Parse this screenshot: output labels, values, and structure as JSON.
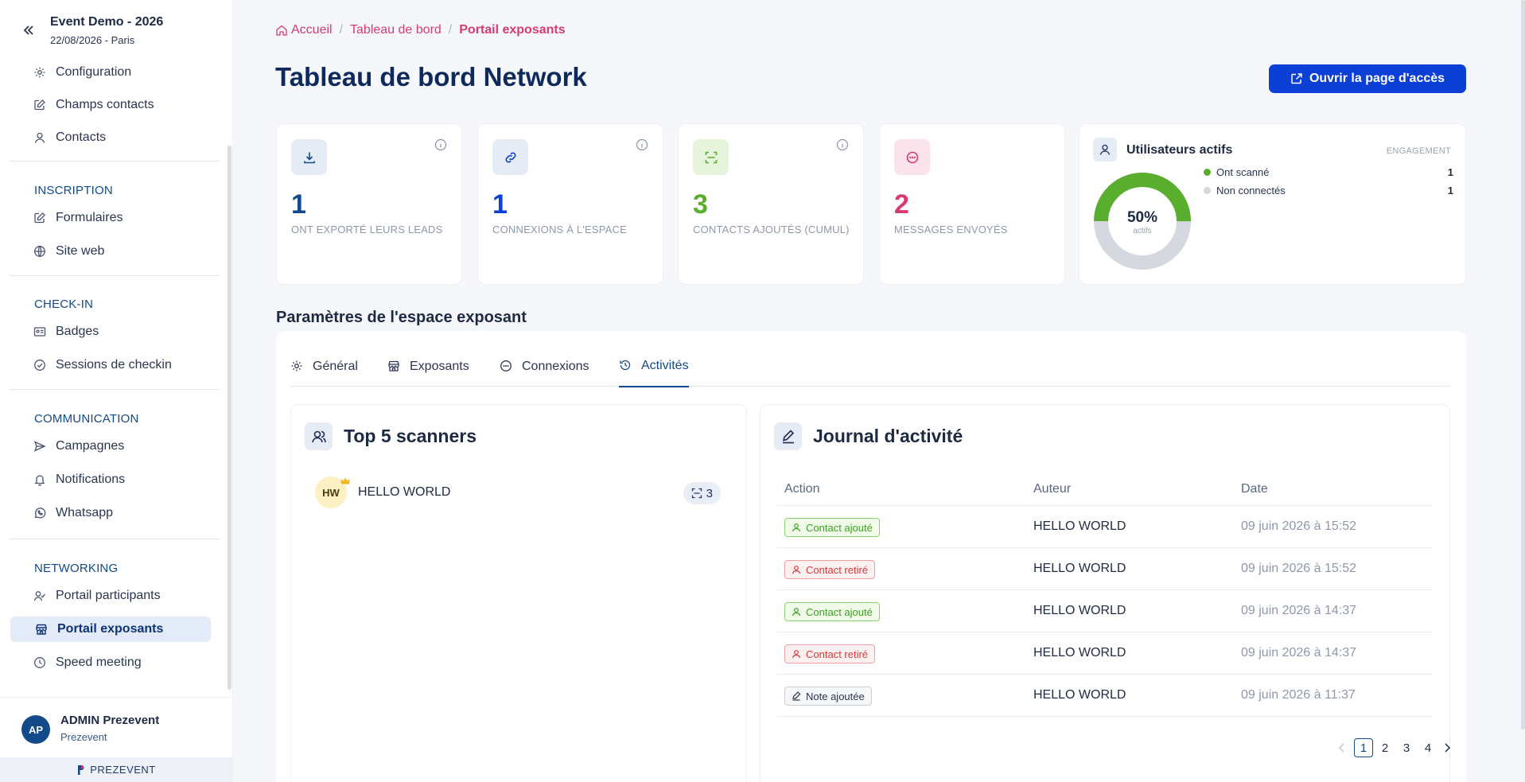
{
  "sidebar": {
    "event_title": "Event Demo - 2026",
    "event_date": "22/08/2026 - Paris",
    "top_items": [
      {
        "label": "Configuration",
        "icon": "gear-icon"
      },
      {
        "label": "Champs contacts",
        "icon": "edit-icon"
      },
      {
        "label": "Contacts",
        "icon": "user-icon"
      }
    ],
    "sections": [
      {
        "title": "INSCRIPTION",
        "items": [
          {
            "label": "Formulaires",
            "icon": "edit-icon"
          },
          {
            "label": "Site web",
            "icon": "globe-icon"
          }
        ]
      },
      {
        "title": "CHECK-IN",
        "items": [
          {
            "label": "Badges",
            "icon": "badge-icon"
          },
          {
            "label": "Sessions de checkin",
            "icon": "check-circle-icon"
          }
        ]
      },
      {
        "title": "COMMUNICATION",
        "items": [
          {
            "label": "Campagnes",
            "icon": "send-icon"
          },
          {
            "label": "Notifications",
            "icon": "bell-icon"
          },
          {
            "label": "Whatsapp",
            "icon": "whatsapp-icon"
          }
        ]
      },
      {
        "title": "NETWORKING",
        "items": [
          {
            "label": "Portail participants",
            "icon": "users-icon"
          },
          {
            "label": "Portail exposants",
            "icon": "store-icon"
          },
          {
            "label": "Speed meeting",
            "icon": "clock-icon"
          }
        ]
      }
    ],
    "user": {
      "initials": "AP",
      "name": "ADMIN Prezevent",
      "org": "Prezevent"
    },
    "brand": "PREZEVENT"
  },
  "breadcrumb": {
    "home": "Accueil",
    "level2": "Tableau de bord",
    "current": "Portail exposants"
  },
  "header": {
    "title": "Tableau de bord Network",
    "open_button": "Ouvrir la page d'accès"
  },
  "stats": [
    {
      "value": "1",
      "label": "ONT EXPORTÉ LEURS LEADS",
      "icon": "download-icon",
      "color": "#124a8a",
      "bg": "#e6ecf6"
    },
    {
      "value": "1",
      "label": "CONNEXIONS À L'ESPACE",
      "icon": "link-icon",
      "color": "#0b3fd6",
      "bg": "#e6ecf6"
    },
    {
      "value": "3",
      "label": "CONTACTS AJOUTÉS (CUMUL)",
      "icon": "scan-icon",
      "color": "#5aae2e",
      "bg": "#e6f4dc"
    },
    {
      "value": "2",
      "label": "MESSAGES ENVOYÉS",
      "icon": "message-icon",
      "color": "#d63c6f",
      "bg": "#fbe3ec"
    }
  ],
  "active_users": {
    "title": "Utilisateurs actifs",
    "tag": "ENGAGEMENT",
    "percent": "50%",
    "percent_sub": "actifs",
    "active_fraction": 0.5,
    "legend": [
      {
        "label": "Ont scanné",
        "count": "1",
        "color": "#5aae2e"
      },
      {
        "label": "Non connectés",
        "count": "1",
        "color": "#d5d8de"
      }
    ]
  },
  "settings": {
    "heading": "Paramètres de l'espace exposant",
    "tabs": [
      {
        "label": "Général",
        "icon": "gear-icon"
      },
      {
        "label": "Exposants",
        "icon": "store-icon"
      },
      {
        "label": "Connexions",
        "icon": "message-icon"
      },
      {
        "label": "Activités",
        "icon": "history-icon"
      }
    ]
  },
  "top_scanners": {
    "title": "Top 5 scanners",
    "rows": [
      {
        "initials": "HW",
        "name": "HELLO WORLD",
        "count": "3"
      }
    ]
  },
  "activity_log": {
    "title": "Journal d'activité",
    "columns": [
      "Action",
      "Auteur",
      "Date"
    ],
    "rows": [
      {
        "action": "Contact ajouté",
        "type": "green",
        "author": "HELLO WORLD",
        "date": "09 juin 2026 à 15:52"
      },
      {
        "action": "Contact retiré",
        "type": "red",
        "author": "HELLO WORLD",
        "date": "09 juin 2026 à 15:52"
      },
      {
        "action": "Contact ajouté",
        "type": "green",
        "author": "HELLO WORLD",
        "date": "09 juin 2026 à 14:37"
      },
      {
        "action": "Contact retiré",
        "type": "red",
        "author": "HELLO WORLD",
        "date": "09 juin 2026 à 14:37"
      },
      {
        "action": "Note ajoutée",
        "type": "gray",
        "author": "HELLO WORLD",
        "date": "09 juin 2026 à 11:37"
      }
    ],
    "pages": [
      "1",
      "2",
      "3",
      "4"
    ]
  }
}
